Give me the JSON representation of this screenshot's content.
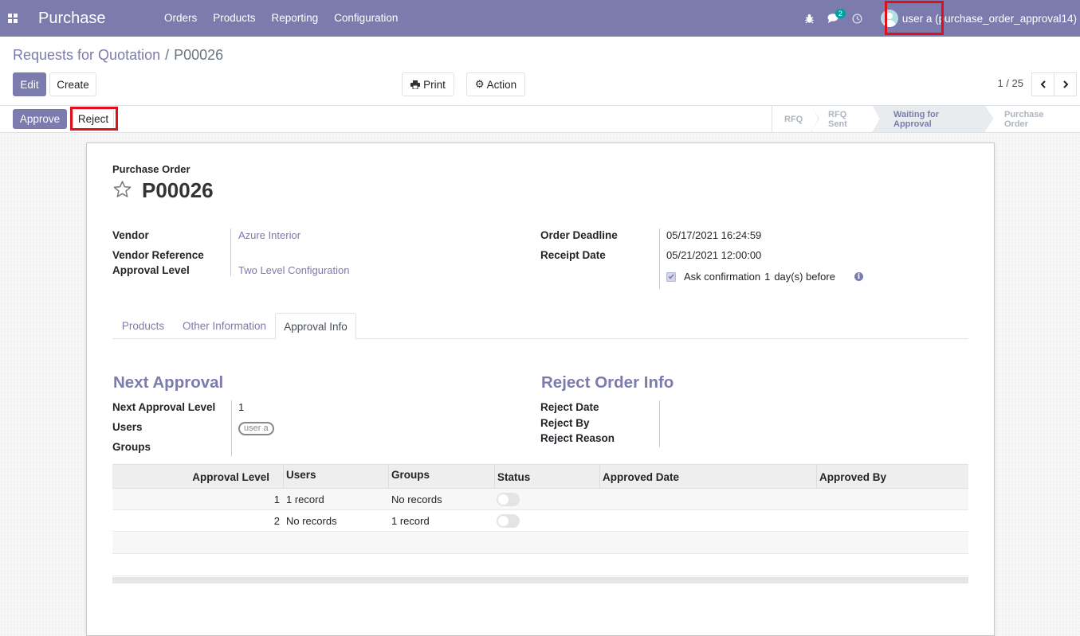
{
  "navbar": {
    "app_name": "Purchase",
    "menu": [
      "Orders",
      "Products",
      "Reporting",
      "Configuration"
    ],
    "chat_badge": "2",
    "user": "user a (purchase_order_approval14)",
    "icons": [
      "apps-grid-icon",
      "bug-icon",
      "chat-icon",
      "clock-icon"
    ]
  },
  "breadcrumb": {
    "parent": "Requests for Quotation",
    "separator": "/",
    "current": "P00026"
  },
  "buttons": {
    "edit": "Edit",
    "create": "Create",
    "print": "Print",
    "action": "Action",
    "approve": "Approve",
    "reject": "Reject"
  },
  "pager": {
    "value": "1 / 25"
  },
  "status_steps": [
    "RFQ",
    "RFQ Sent",
    "Waiting for Approval",
    "Purchase Order"
  ],
  "active_step": "Waiting for Approval",
  "form": {
    "type_label": "Purchase Order",
    "name": "P00026",
    "vendor_label": "Vendor",
    "vendor": "Azure Interior",
    "vendor_ref_label": "Vendor Reference",
    "approval_level_label": "Approval Level",
    "approval_level": "Two Level Configuration",
    "order_deadline_label": "Order Deadline",
    "order_deadline": "05/17/2021 16:24:59",
    "receipt_date_label": "Receipt Date",
    "receipt_date": "05/21/2021 12:00:00",
    "ask_confirmation_label": "Ask confirmation",
    "ask_confirmation_days": "1",
    "ask_confirmation_suffix": "day(s) before"
  },
  "tabs": [
    "Products",
    "Other Information",
    "Approval Info"
  ],
  "active_tab": "Approval Info",
  "next_approval": {
    "title": "Next Approval",
    "level_label": "Next Approval Level",
    "level": "1",
    "users_label": "Users",
    "users_tag": "user a",
    "groups_label": "Groups"
  },
  "reject_info": {
    "title": "Reject Order Info",
    "date_label": "Reject Date",
    "by_label": "Reject By",
    "reason_label": "Reject Reason"
  },
  "approval_table": {
    "columns": [
      "Approval Level",
      "Users",
      "Groups",
      "Status",
      "Approved Date",
      "Approved By"
    ],
    "rows": [
      {
        "level": "1",
        "users": "1 record",
        "groups": "No records",
        "status": false,
        "approved_date": "",
        "approved_by": ""
      },
      {
        "level": "2",
        "users": "No records",
        "groups": "1 record",
        "status": false,
        "approved_date": "",
        "approved_by": ""
      }
    ]
  },
  "colors": {
    "brand": "#7c7bad",
    "highlight": "#e0101b",
    "badge": "#00a09d"
  }
}
